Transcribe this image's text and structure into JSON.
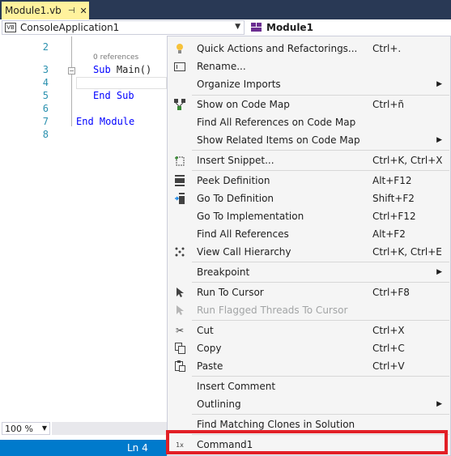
{
  "tab": {
    "name": "Module1.vb",
    "pin": "⊣",
    "close": "✕"
  },
  "nav": {
    "project": "ConsoleApplication1",
    "module": "Module1",
    "project_badge": "VB"
  },
  "editor": {
    "line_numbers": [
      "2",
      "3",
      "4",
      "5",
      "6",
      "7",
      "8"
    ],
    "codelens": "0 references",
    "line3": {
      "kw": "Sub",
      "rest": " Main()"
    },
    "line5": {
      "kw": "End Sub"
    },
    "line7": {
      "kw": "End Module"
    }
  },
  "zoom": "100 %",
  "status": {
    "ln": "Ln 4"
  },
  "menu": {
    "items": [
      {
        "label": "Quick Actions and Refactorings...",
        "shortcut": "Ctrl+.",
        "icon": "lightbulb-icon"
      },
      {
        "label": "Rename...",
        "shortcut": "",
        "icon": "rename-icon"
      },
      {
        "label": "Organize Imports",
        "shortcut": "",
        "icon": "",
        "submenu": true
      },
      {
        "label": "Show on Code Map",
        "shortcut": "Ctrl+ñ",
        "icon": "code-map-icon"
      },
      {
        "label": "Find All References on Code Map",
        "shortcut": "",
        "icon": ""
      },
      {
        "label": "Show Related Items on Code Map",
        "shortcut": "",
        "icon": "",
        "submenu": true
      },
      {
        "label": "Insert Snippet...",
        "shortcut": "Ctrl+K, Ctrl+X",
        "icon": "snippet-icon"
      },
      {
        "label": "Peek Definition",
        "shortcut": "Alt+F12",
        "icon": "peek-icon"
      },
      {
        "label": "Go To Definition",
        "shortcut": "Shift+F2",
        "icon": "goto-definition-icon"
      },
      {
        "label": "Go To Implementation",
        "shortcut": "Ctrl+F12",
        "icon": ""
      },
      {
        "label": "Find All References",
        "shortcut": "Alt+F2",
        "icon": ""
      },
      {
        "label": "View Call Hierarchy",
        "shortcut": "Ctrl+K, Ctrl+E",
        "icon": "call-hierarchy-icon"
      },
      {
        "label": "Breakpoint",
        "shortcut": "",
        "icon": "",
        "submenu": true
      },
      {
        "label": "Run To Cursor",
        "shortcut": "Ctrl+F8",
        "icon": "cursor-icon"
      },
      {
        "label": "Run Flagged Threads To Cursor",
        "shortcut": "",
        "icon": "cursor-icon",
        "disabled": true
      },
      {
        "label": "Cut",
        "shortcut": "Ctrl+X",
        "icon": "scissors-icon"
      },
      {
        "label": "Copy",
        "shortcut": "Ctrl+C",
        "icon": "copy-icon"
      },
      {
        "label": "Paste",
        "shortcut": "Ctrl+V",
        "icon": "paste-icon"
      },
      {
        "label": "Insert Comment",
        "shortcut": "",
        "icon": ""
      },
      {
        "label": "Outlining",
        "shortcut": "",
        "icon": "",
        "submenu": true
      },
      {
        "label": "Find Matching Clones in Solution",
        "shortcut": "",
        "icon": ""
      },
      {
        "label": "Command1",
        "shortcut": "",
        "icon": "1x"
      }
    ]
  },
  "colors": {
    "highlight": "#e21f26",
    "status": "#007acc",
    "tab": "#fff29d"
  }
}
